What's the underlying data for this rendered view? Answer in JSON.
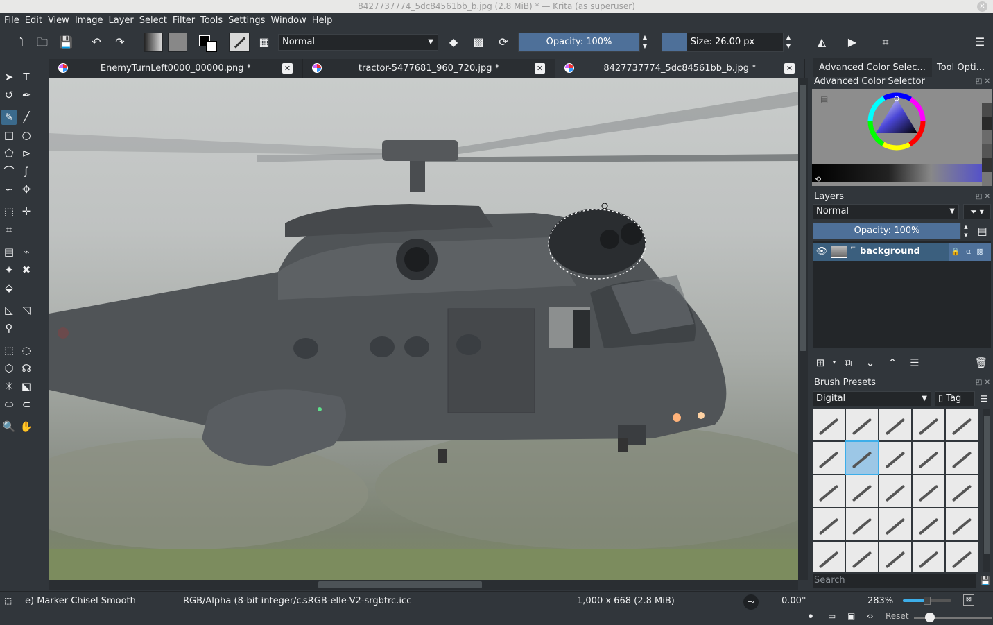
{
  "window": {
    "title": "8427737774_5dc84561bb_b.jpg (2.8 MiB)  * — Krita (as superuser)"
  },
  "menu": [
    "File",
    "Edit",
    "View",
    "Image",
    "Layer",
    "Select",
    "Filter",
    "Tools",
    "Settings",
    "Window",
    "Help"
  ],
  "toolbar": {
    "blend_mode": "Normal",
    "opacity_label": "Opacity: 100%",
    "opacity_value": 1.0,
    "size_label": "Size: 26.00 px",
    "size_value": 26.0
  },
  "tabs": [
    {
      "label": "EnemyTurnLeft0000_00000.png *",
      "active": false
    },
    {
      "label": "tractor-5477681_960_720.jpg *",
      "active": false
    },
    {
      "label": "8427737774_5dc84561bb_b.jpg *",
      "active": true
    }
  ],
  "dock": {
    "tabs": [
      "Advanced Color Selec...",
      "Tool Opti..."
    ],
    "color_selector_title": "Advanced Color Selector",
    "layers_title": "Layers",
    "layers_blend": "Normal",
    "layers_opacity": "Opacity:  100%",
    "layer_name": "background",
    "brush_presets_title": "Brush Presets",
    "brush_tag_select": "Digital",
    "tag_button": "Tag",
    "search_placeholder": "Search",
    "selected_preset_index": 6
  },
  "status": {
    "brush_name": "e) Marker Chisel Smooth",
    "color_space": "RGB/Alpha (8-bit integer/c...",
    "profile": "sRGB-elle-V2-srgbtrc.icc",
    "dimensions": "1,000 x 668 (2.8 MiB)",
    "rotation": "0.00°",
    "zoom": "283%",
    "reset": "Reset"
  },
  "colors": {
    "accent": "#3daee9",
    "selection_fill": "#4e7099",
    "background": "#31363b",
    "dark": "#232629"
  },
  "icons": [
    "new-document-icon",
    "open-icon",
    "save-icon",
    "undo-icon",
    "redo-icon",
    "eraser-icon",
    "mirror-icon",
    "crop-icon"
  ]
}
